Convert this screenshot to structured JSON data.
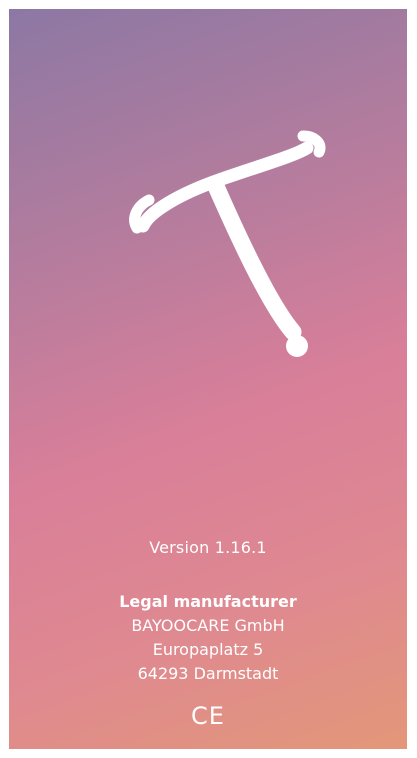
{
  "app": {
    "logo_icon": "iud-icon",
    "background_colors": [
      "#8c78a4",
      "#d97f99",
      "#e39778"
    ]
  },
  "info": {
    "version": "Version 1.16.1",
    "manufacturer_heading": "Legal manufacturer",
    "company": "BAYOOCARE GmbH",
    "street": "Europaplatz 5",
    "city": "64293 Darmstadt",
    "ce_mark": "CE"
  }
}
